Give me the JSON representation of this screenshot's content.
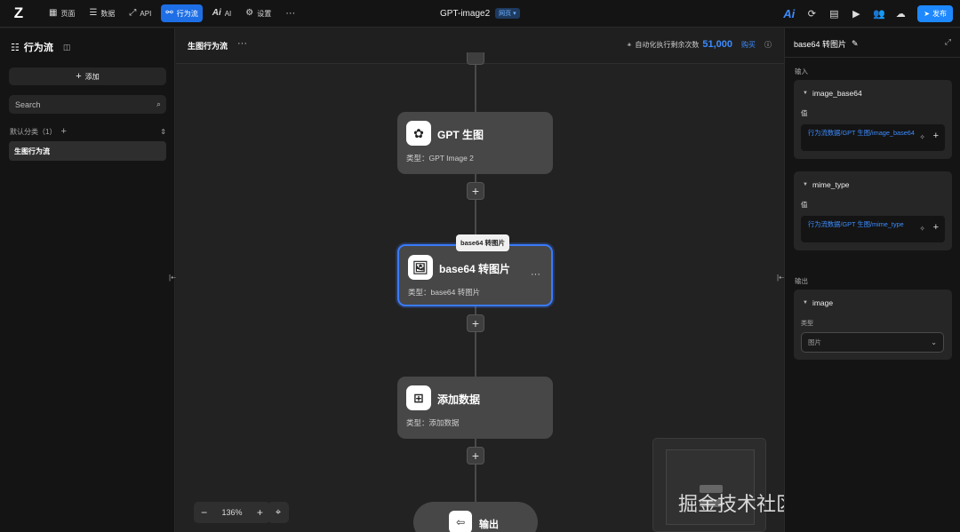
{
  "topbar": {
    "logo": "Z",
    "nav": [
      {
        "icon": "page-icon",
        "glyph": "▦",
        "label": "页面",
        "active": false
      },
      {
        "icon": "database-icon",
        "glyph": "☰",
        "label": "数据",
        "active": false
      },
      {
        "icon": "api-icon",
        "glyph": "⤢",
        "label": "API",
        "active": false
      },
      {
        "icon": "flow-icon",
        "glyph": "⚯",
        "label": "行为流",
        "active": true
      },
      {
        "icon": "ai-icon",
        "glyph": "Ai",
        "label": "AI",
        "active": false
      },
      {
        "icon": "gear-icon",
        "glyph": "⚙",
        "label": "设置",
        "active": false
      }
    ],
    "more": "···",
    "app_title": "GPT-image2",
    "app_badge": "网页 ▾",
    "ai_logo": "Ai",
    "publish_label": "发布"
  },
  "left_panel": {
    "title": "行为流",
    "add_label": "添加",
    "search_placeholder": "Search",
    "category": "默认分类（1）",
    "flows": [
      "生图行为流"
    ]
  },
  "canvas": {
    "flow_title": "生图行为流",
    "more": "···",
    "quota_label": "自动化执行剩余次数",
    "quota_value": "51,000",
    "buy_label": "购买",
    "nodes": [
      {
        "name": "GPT 生图",
        "type": "类型：GPT Image 2",
        "icon": "openai-icon"
      },
      {
        "name": "base64 转图片",
        "type": "类型：base64 转图片",
        "icon": "image-convert-icon"
      },
      {
        "name": "添加数据",
        "type": "类型：添加数据",
        "icon": "add-data-icon"
      }
    ],
    "tooltip": "base64 转图片",
    "output_node": "输出",
    "zoom": "136%",
    "watermark": "掘金技术社区 @ 代码青铜z"
  },
  "right_panel": {
    "title": "base64 转图片",
    "input_label": "输入",
    "output_label": "输出",
    "inputs": [
      {
        "name": "image_base64",
        "value_label": "值",
        "value": "行为流数据/GPT 生图/image_base64"
      },
      {
        "name": "mime_type",
        "value_label": "值",
        "value": "行为流数据/GPT 生图/mime_type"
      }
    ],
    "output": {
      "name": "image",
      "type_label": "类型",
      "type_value": "图片"
    }
  },
  "colors": {
    "accent": "#1e88ff",
    "selected_border": "#3a7bff",
    "link": "#3c8cff"
  }
}
